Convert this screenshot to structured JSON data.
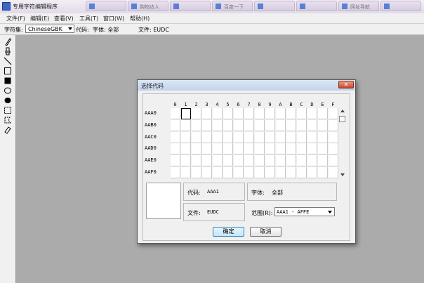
{
  "window": {
    "title": "专用字符编辑程序"
  },
  "taskbar_tabs": [
    {
      "label": "",
      "icon": "window-icon"
    },
    {
      "label": "购物达人",
      "icon": "window-icon"
    },
    {
      "label": "",
      "icon": "window-icon"
    },
    {
      "label": "百度一下",
      "icon": "window-icon"
    },
    {
      "label": "",
      "icon": "window-icon"
    },
    {
      "label": "",
      "icon": "window-icon"
    },
    {
      "label": "网址导航",
      "icon": "window-icon"
    },
    {
      "label": "",
      "icon": "window-icon"
    }
  ],
  "menu": [
    "文件(F)",
    "编辑(E)",
    "查看(V)",
    "工具(T)",
    "窗口(W)",
    "帮助(H)"
  ],
  "toolbar": {
    "charset_label": "字符集:",
    "charset_value": "ChineseGBK",
    "code_label": "代码:",
    "font_label": "字体: 全部",
    "file_label": "文件: EUDC"
  },
  "tools": [
    "pencil-icon",
    "brush-icon",
    "line-icon",
    "hollow-rectangle-icon",
    "filled-rectangle-icon",
    "hollow-ellipse-icon",
    "filled-ellipse-icon",
    "rect-select-icon",
    "freeform-select-icon",
    "eraser-icon"
  ],
  "dialog": {
    "title": "选择代码",
    "close_label": "✕",
    "column_headers": [
      "0",
      "1",
      "2",
      "3",
      "4",
      "5",
      "6",
      "7",
      "8",
      "9",
      "A",
      "B",
      "C",
      "D",
      "E",
      "F"
    ],
    "row_headers": [
      "AAA0",
      "AAB0",
      "AAC0",
      "AAD0",
      "AAE0",
      "AAF0"
    ],
    "selected_cell": 1,
    "code_label": "代码:",
    "code_value": "AAA1",
    "font_label": "字体:",
    "font_value": "全部",
    "file_label": "文件:",
    "file_value": "EUDC",
    "range_label": "范围(R):",
    "range_value": "AAA1 - AFFE",
    "ok_label": "确定",
    "cancel_label": "取消"
  }
}
